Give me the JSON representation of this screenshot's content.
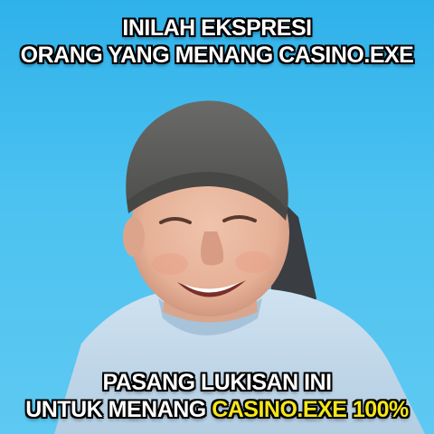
{
  "meme": {
    "top_lines": [
      "INILAH EKSPRESI",
      "ORANG YANG MENANG CASINO.EXE"
    ],
    "bottom_line_1": "PASANG LUKISAN INI",
    "bottom_line_2_prefix": "UNTUK MENANG ",
    "bottom_line_2_highlight": "CASINO.EXE 100%",
    "colors": {
      "background": "#3dbcef",
      "caption_text": "#ffffff",
      "caption_outline": "#000000",
      "highlight_text": "#f5e619",
      "beanie": "#5d5d5b",
      "skin": "#e9b79e",
      "shirt": "#c3d9ea"
    }
  }
}
